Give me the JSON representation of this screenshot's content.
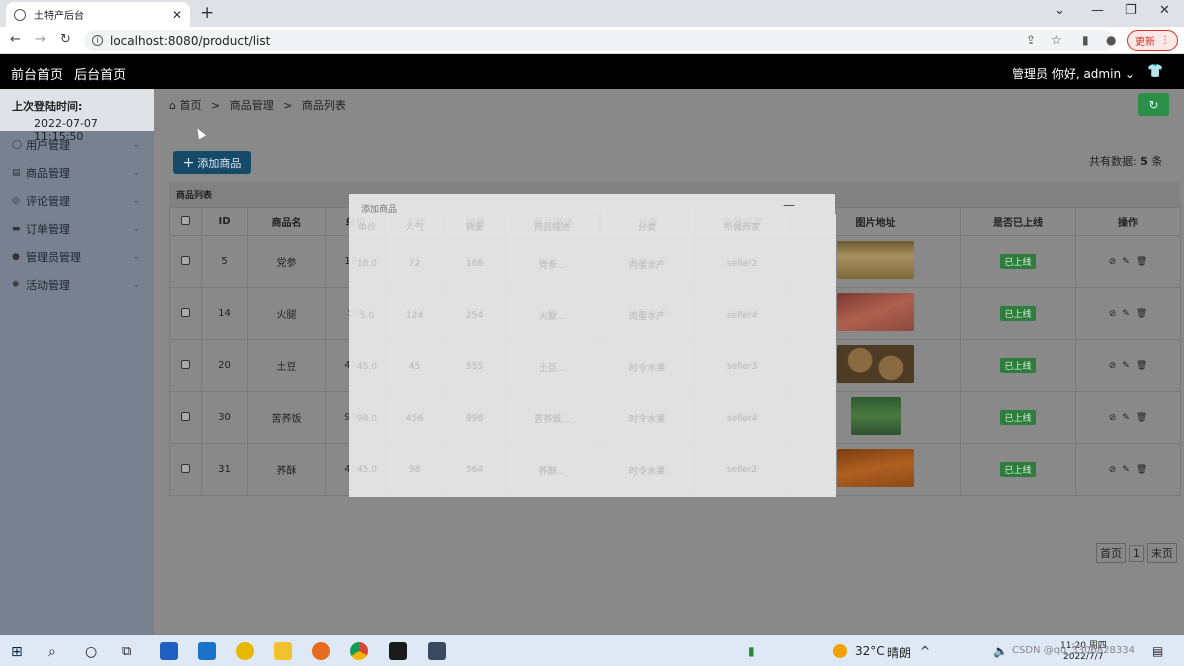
{
  "browser": {
    "tab_title": "土特产后台",
    "url": "localhost:8080/product/list",
    "update_label": "更新"
  },
  "header": {
    "front_link": "前台首页",
    "back_link": "后台首页",
    "user_greeting": "管理员  你好, admin"
  },
  "sidebar": {
    "last_login_label": "上次登陆时间:",
    "last_login_value": "2022-07-07 11:15:50",
    "items": [
      {
        "label": "用户管理",
        "icon": "user-icon"
      },
      {
        "label": "商品管理",
        "icon": "goods-icon"
      },
      {
        "label": "评论管理",
        "icon": "comment-icon"
      },
      {
        "label": "订单管理",
        "icon": "order-icon"
      },
      {
        "label": "管理员管理",
        "icon": "admin-icon"
      },
      {
        "label": "活动管理",
        "icon": "activity-icon"
      }
    ]
  },
  "breadcrumb": {
    "home": "首页",
    "section": "商品管理",
    "page": "商品列表"
  },
  "toolbar": {
    "add_label": "添加商品",
    "total_prefix": "共有数据:",
    "total_count": "5",
    "total_suffix": "条"
  },
  "panel_title": "商品列表",
  "table": {
    "headers": [
      "ID",
      "商品名",
      "单价",
      "人气",
      "销量",
      "商品描述",
      "分类",
      "所属商家",
      "图片地址",
      "是否已上线",
      "操作"
    ],
    "rows": [
      {
        "id": "5",
        "name": "党参",
        "price": "18.0",
        "popularity": "72",
        "sales": "168",
        "desc": "党参...",
        "category": "肉蛋水产",
        "seller": "seller2",
        "status": "已上线"
      },
      {
        "id": "14",
        "name": "火腿",
        "price": "5.0",
        "popularity": "124",
        "sales": "254",
        "desc": "火腿...",
        "category": "肉蛋水产",
        "seller": "seller4",
        "status": "已上线"
      },
      {
        "id": "20",
        "name": "土豆",
        "price": "45.0",
        "popularity": "45",
        "sales": "555",
        "desc": "土豆...",
        "category": "时令水果",
        "seller": "seller3",
        "status": "已上线"
      },
      {
        "id": "30",
        "name": "苦荞饭",
        "price": "98.0",
        "popularity": "456",
        "sales": "998",
        "desc": "苦荞饭...",
        "category": "时令水果",
        "seller": "seller4",
        "status": "已上线"
      },
      {
        "id": "31",
        "name": "荞酥",
        "price": "45.0",
        "popularity": "98",
        "sales": "564",
        "desc": "荞酥...",
        "category": "时令水果",
        "seller": "seller2",
        "status": "已上线"
      }
    ]
  },
  "pager": {
    "first": "首页",
    "page": "1",
    "last": "末页"
  },
  "modal": {
    "title": "添加商品",
    "minimize": "—"
  },
  "taskbar": {
    "weather_temp": "32°C",
    "weather_desc": "晴朗",
    "time": "11:20 周四",
    "date": "2022/7/7",
    "watermark": "CSDN @qq_3306828334"
  }
}
